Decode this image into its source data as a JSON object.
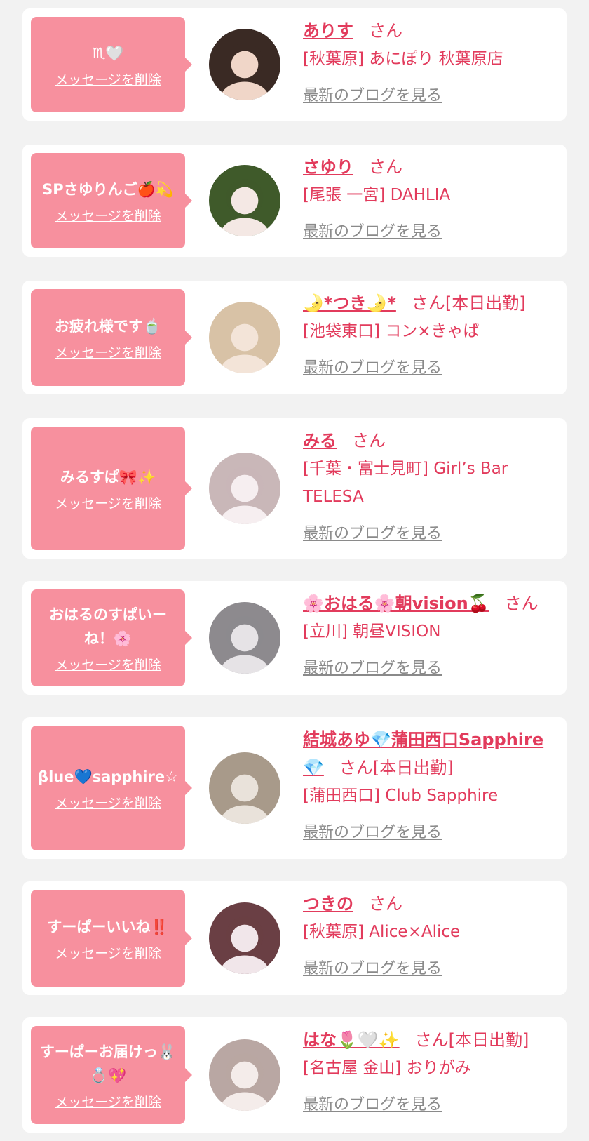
{
  "cards": [
    {
      "message": "♏🤍",
      "delete_label": "メッセージを削除",
      "name": "ありす",
      "suffix": "さん",
      "shop": "[秋葉原] あにぽり 秋葉原店",
      "blog_label": "最新のブログを見る",
      "avatar_colors": [
        "#3a2a24",
        "#f0d6c8"
      ]
    },
    {
      "message": "SPさゆりんご🍎💫",
      "delete_label": "メッセージを削除",
      "name": "さゆり",
      "suffix": "さん",
      "shop": "[尾張 一宮] DAHLIA",
      "blog_label": "最新のブログを見る",
      "avatar_colors": [
        "#3f5a2a",
        "#f4e8e4"
      ]
    },
    {
      "message": "お疲れ様です🍵",
      "delete_label": "メッセージを削除",
      "name": "🌛*つき🌛*",
      "suffix": "さん[本日出勤]",
      "shop": "[池袋東口] コン×きゃば",
      "blog_label": "最新のブログを見る",
      "avatar_colors": [
        "#d8c2a6",
        "#f3e4d8"
      ]
    },
    {
      "message": "みるすぱ🎀✨",
      "delete_label": "メッセージを削除",
      "name": "みる",
      "suffix": "さん",
      "shop": "[千葉・富士見町] Girl’s Bar TELESA",
      "blog_label": "最新のブログを見る",
      "avatar_colors": [
        "#c9b7b8",
        "#f6eef0"
      ]
    },
    {
      "message": "おはるのすぱいーね！🌸",
      "delete_label": "メッセージを削除",
      "name": "🌸おはる🌸朝vision🍒",
      "suffix": "さん",
      "shop": "[立川] 朝昼VISION",
      "blog_label": "最新のブログを見る",
      "avatar_colors": [
        "#8d8a8e",
        "#e6e3e6"
      ]
    },
    {
      "message": "βlue💙sapphire☆",
      "delete_label": "メッセージを削除",
      "name": "結城あゆ💎蒲田西口Sapphire💎",
      "suffix": "さん[本日出勤]",
      "shop": "[蒲田西口] Club Sapphire",
      "blog_label": "最新のブログを見る",
      "avatar_colors": [
        "#a89a8a",
        "#e9e2da"
      ]
    },
    {
      "message": "すーぱーいいね‼️",
      "delete_label": "メッセージを削除",
      "name": "つきの",
      "suffix": "さん",
      "shop": "[秋葉原] Alice×Alice",
      "blog_label": "最新のブログを見る",
      "avatar_colors": [
        "#6a3f44",
        "#f1e6ea"
      ]
    },
    {
      "message": "すーぱーお届けっ🐰💍💖",
      "delete_label": "メッセージを削除",
      "name": "はな🌷🤍✨",
      "suffix": "さん[本日出勤]",
      "shop": "[名古屋 金山] おりがみ",
      "blog_label": "最新のブログを見る",
      "avatar_colors": [
        "#b9a7a3",
        "#f4ecea"
      ]
    }
  ]
}
